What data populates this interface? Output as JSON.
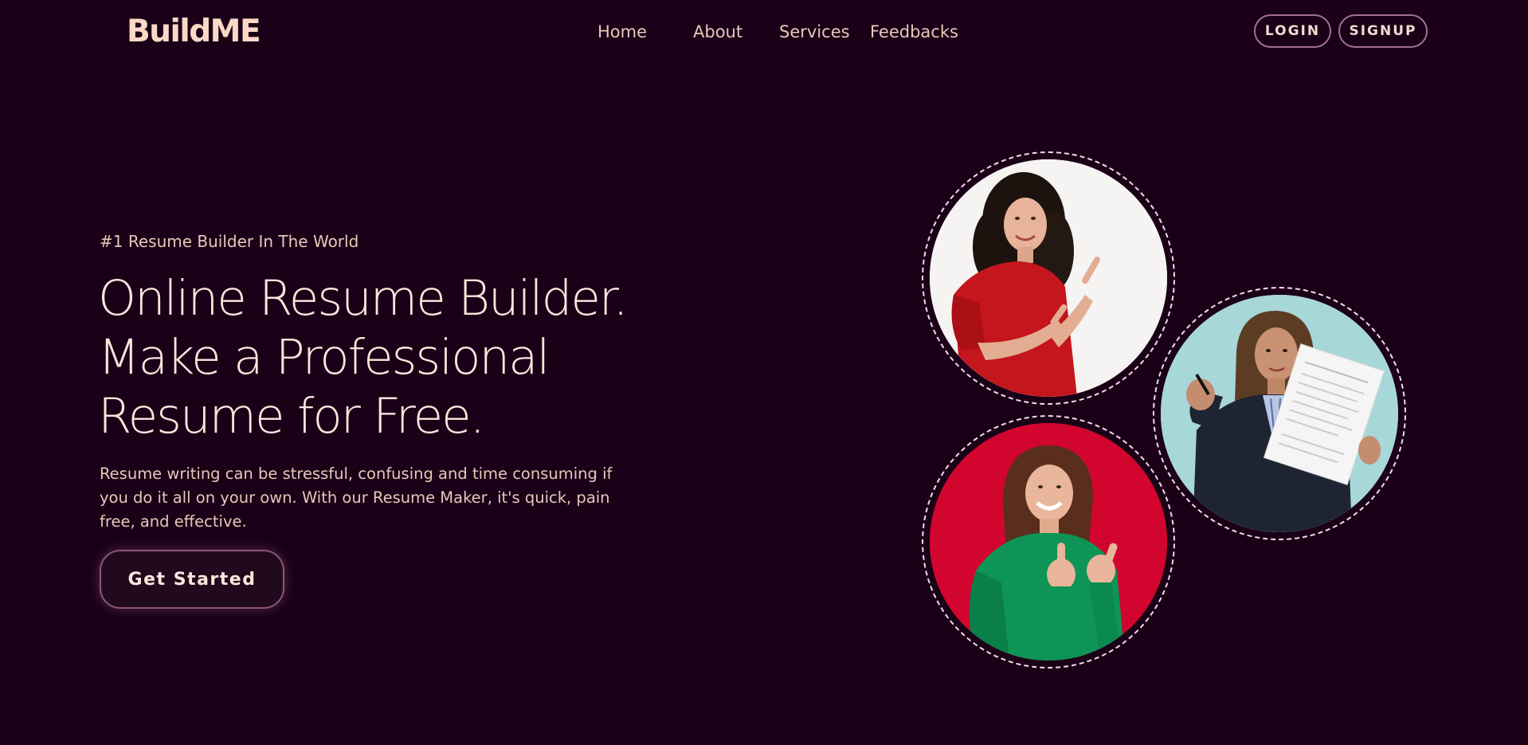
{
  "header": {
    "logo": "BuildME",
    "nav": {
      "home": "Home",
      "about": "About",
      "services": "Services",
      "feedbacks": "Feedbacks"
    },
    "login": "LOGIN",
    "signup": "SIGNUP"
  },
  "hero": {
    "tagline": "#1 Resume Builder In The World",
    "headline": [
      "Online Resume Builder.",
      "Make a Professional",
      "Resume for Free."
    ],
    "description": "Resume writing can be stressful, confusing and time consuming if you do it all on your own. With our Resume Maker, it's quick, pain free, and effective.",
    "cta": "Get Started"
  },
  "colors": {
    "background": "#1a0118",
    "logo": "#fbd9c6",
    "text": "#e9c7b9",
    "button_border": "#8a5677"
  },
  "photos": [
    {
      "name": "woman-red-shirt-pointing",
      "background": "#f6f4f3"
    },
    {
      "name": "woman-blazer-holding-resume",
      "background": "#a8d7d9"
    },
    {
      "name": "woman-green-sweater-thumbs-up",
      "background": "#d1052d"
    }
  ]
}
